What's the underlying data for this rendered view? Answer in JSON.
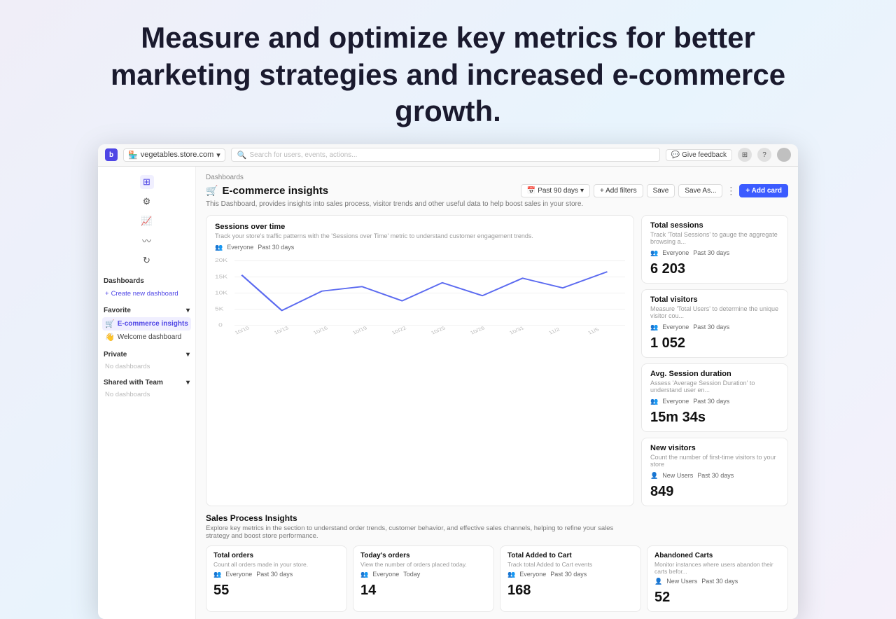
{
  "hero": {
    "title": "Measure and optimize key metrics for better marketing strategies and increased e-commerce growth."
  },
  "topbar": {
    "app_initial": "b",
    "store_name": "vegetables.store.com",
    "search_placeholder": "Search for users, events, actions...",
    "feedback_label": "Give feedback"
  },
  "sidebar": {
    "dashboards_label": "Dashboards",
    "create_label": "Create new dashboard",
    "favorite_label": "Favorite",
    "favorite_chevron": "▾",
    "items": [
      {
        "label": "E-commerce insights",
        "icon": "📊",
        "active": true
      },
      {
        "label": "Welcome dashboard",
        "icon": "👋",
        "active": false
      }
    ],
    "private_label": "Private",
    "private_empty": "No dashboards",
    "shared_label": "Shared with Team",
    "shared_empty": "No dashboards"
  },
  "dashboard": {
    "breadcrumb": "Dashboards",
    "title": "E-commerce insights",
    "title_icon": "🛒",
    "description": "This Dashboard, provides insights into sales process, visitor trends and other useful data to help boost sales in your store.",
    "period_label": "Past 90 days",
    "add_filters_label": "+ Add filters",
    "save_label": "Save",
    "save_as_label": "Save As...",
    "add_card_label": "+ Add card"
  },
  "sessions_chart": {
    "title": "Sessions over time",
    "description": "Track your store's traffic patterns with the 'Sessions over Time' metric to understand customer engagement trends.",
    "filter_everyone": "Everyone",
    "filter_period": "Past 30 days",
    "x_labels": [
      "10/10",
      "10/13",
      "10/16",
      "10/19",
      "10/22",
      "10/25",
      "10/28",
      "10/31",
      "11/2",
      "11/5"
    ],
    "y_labels": [
      "20K",
      "15K",
      "10K",
      "5K",
      "0"
    ],
    "data_points": [
      {
        "x": 0,
        "y": 72
      },
      {
        "x": 1,
        "y": 28
      },
      {
        "x": 2,
        "y": 48
      },
      {
        "x": 3,
        "y": 55
      },
      {
        "x": 4,
        "y": 38
      },
      {
        "x": 5,
        "y": 62
      },
      {
        "x": 6,
        "y": 42
      },
      {
        "x": 7,
        "y": 68
      },
      {
        "x": 8,
        "y": 55
      },
      {
        "x": 9,
        "y": 78
      }
    ]
  },
  "total_sessions": {
    "title": "Total sessions",
    "description": "Track 'Total Sessions' to gauge the aggregate browsing a...",
    "filter_everyone": "Everyone",
    "filter_period": "Past 30 days",
    "value": "6 203"
  },
  "total_visitors": {
    "title": "Total visitors",
    "description": "Measure 'Total Users' to determine the unique visitor cou...",
    "filter_everyone": "Everyone",
    "filter_period": "Past 30 days",
    "value": "1 052"
  },
  "avg_session": {
    "title": "Avg. Session duration",
    "description": "Assess 'Average Session Duration' to understand user en...",
    "filter_everyone": "Everyone",
    "filter_period": "Past 30 days",
    "value": "15m 34s"
  },
  "new_visitors": {
    "title": "New visitors",
    "description": "Count the number of first-time visitors to your store",
    "filter_users": "New Users",
    "filter_period": "Past 30 days",
    "value": "849"
  },
  "sales_insights": {
    "title": "Sales Process Insights",
    "description": "Explore key metrics in the section to understand order trends, customer behavior, and effective sales channels, helping to refine your sales strategy and boost store performance."
  },
  "total_orders": {
    "title": "Total orders",
    "description": "Count all orders made in your store.",
    "filter_everyone": "Everyone",
    "filter_period": "Past 30 days",
    "value": "55"
  },
  "todays_orders": {
    "title": "Today's orders",
    "description": "View the number of orders placed today.",
    "filter_everyone": "Everyone",
    "filter_period": "Today",
    "value": "14"
  },
  "total_added_cart": {
    "title": "Total Added to Cart",
    "description": "Track total Added to Cart events",
    "filter_everyone": "Everyone",
    "filter_period": "Past 30 days",
    "value": "168"
  },
  "abandoned_carts": {
    "title": "Abandoned Carts",
    "description": "Monitor instances where users abandon their carts befor...",
    "filter_users": "New Users",
    "filter_period": "Past 30 days",
    "value": "52"
  }
}
